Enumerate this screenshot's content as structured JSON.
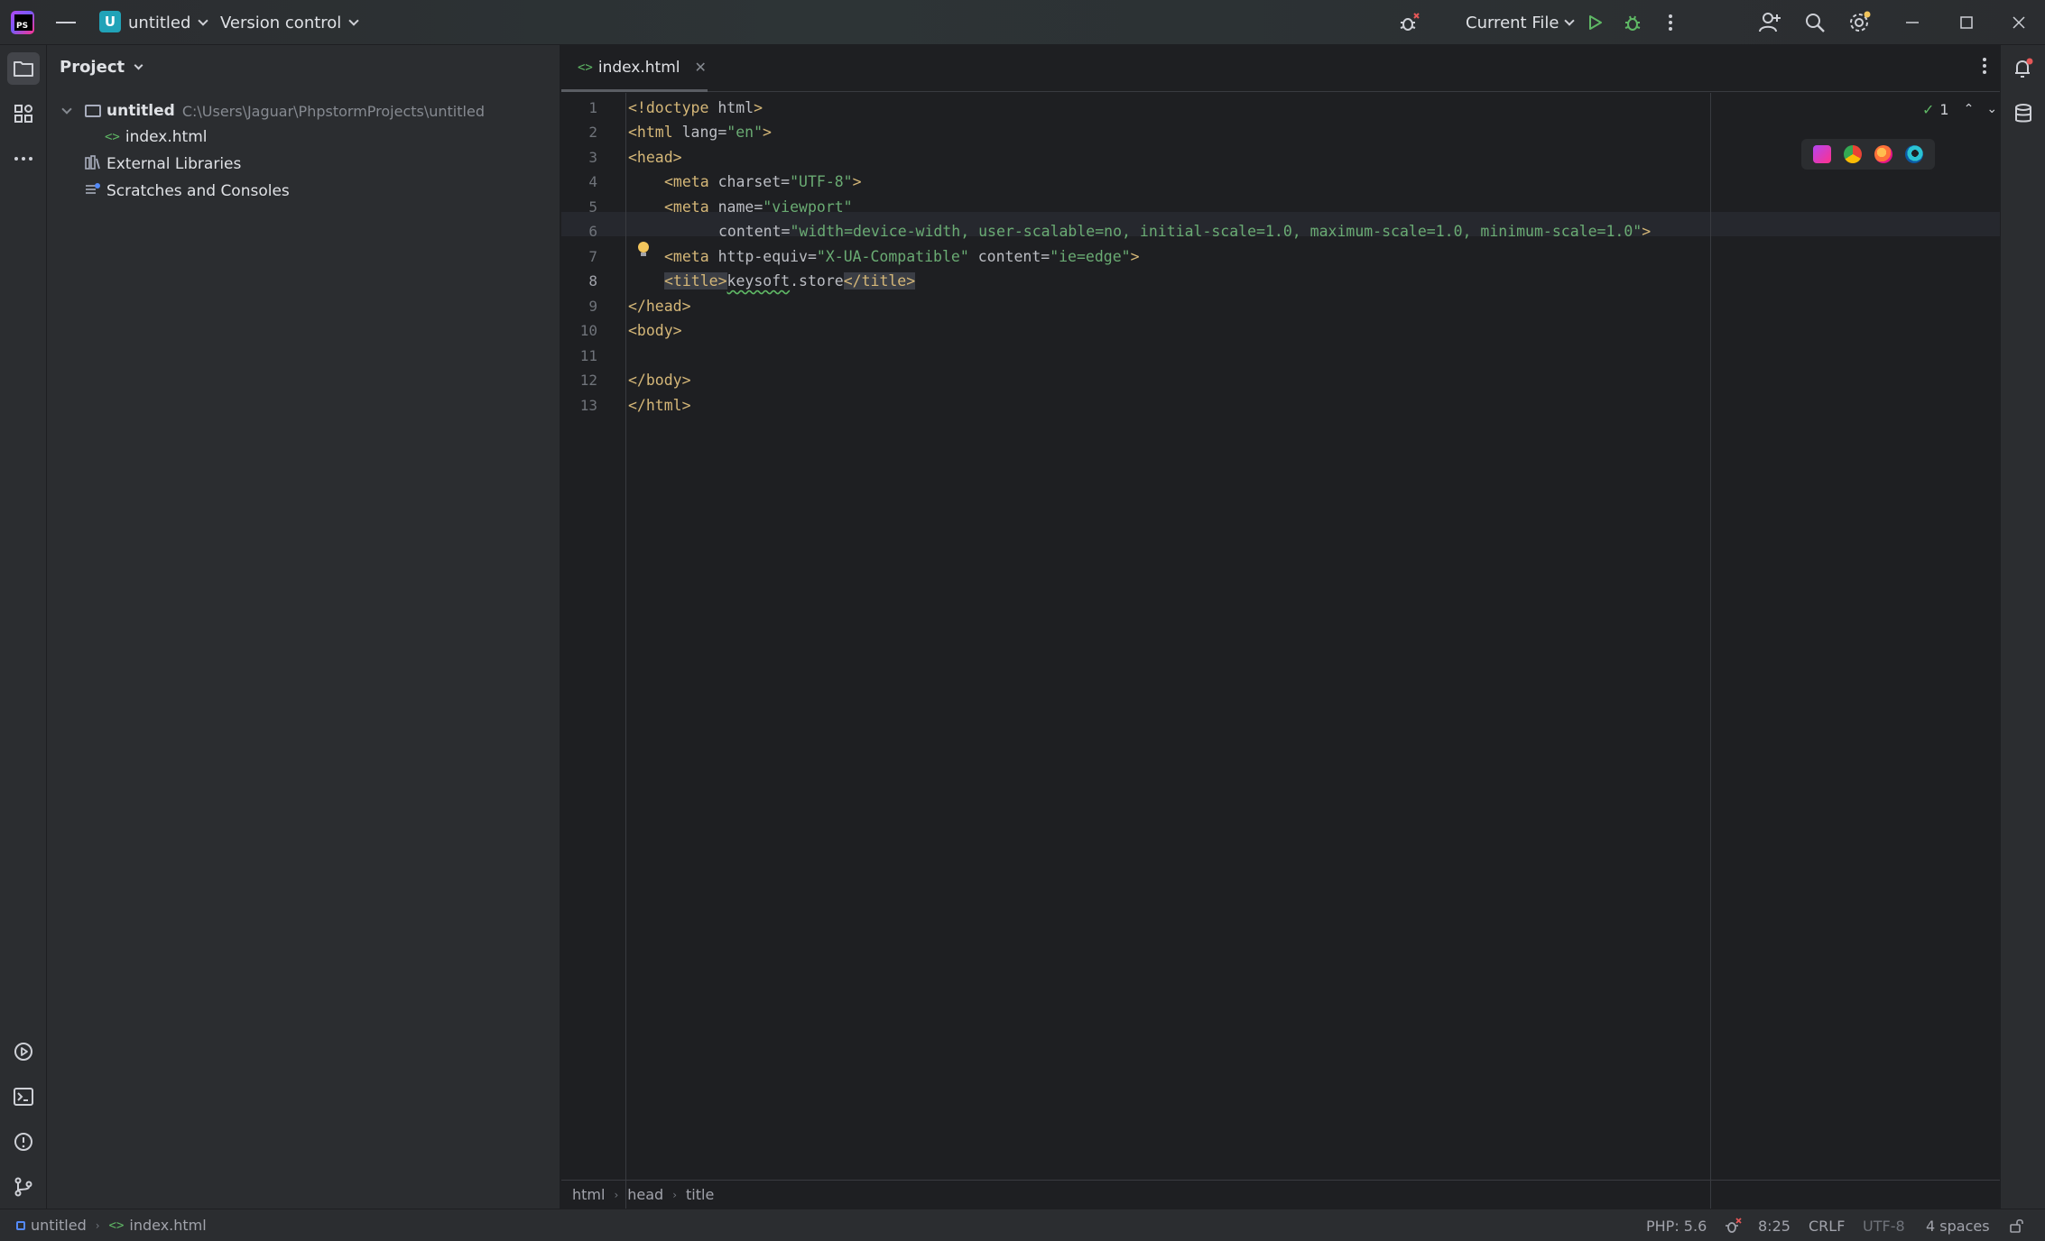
{
  "titlebar": {
    "project_badge": "U",
    "project_name": "untitled",
    "vcs_label": "Version control",
    "run_config": "Current File",
    "icons": [
      "menu-icon",
      "debug-bug-icon",
      "run-icon",
      "debug-icon",
      "more-vertical-icon",
      "add-user-icon",
      "search-icon",
      "settings-icon",
      "minimize-icon",
      "maximize-icon",
      "close-icon"
    ]
  },
  "project_panel": {
    "title": "Project",
    "tree": [
      {
        "label": "untitled",
        "path": "C:\\Users\\Jaguar\\PhpstormProjects\\untitled"
      },
      {
        "label": "index.html"
      },
      {
        "label": "External Libraries"
      },
      {
        "label": "Scratches and Consoles"
      }
    ]
  },
  "editor": {
    "tab_label": "index.html",
    "current_line": 8,
    "line_numbers": [
      "1",
      "2",
      "3",
      "4",
      "5",
      "6",
      "7",
      "8",
      "9",
      "10",
      "11",
      "12",
      "13"
    ],
    "code": {
      "l1": {
        "tag": "<!doctype",
        "rest": " html",
        "close": ">"
      },
      "l2": {
        "tag": "<html",
        "attr": " lang=",
        "val": "\"en\"",
        "close": ">"
      },
      "l3": {
        "tag": "<head>"
      },
      "l4": {
        "tag": "<meta",
        "attr": " charset=",
        "val": "\"UTF-8\"",
        "close": ">"
      },
      "l5": {
        "tag": "<meta",
        "attr": " name=",
        "val": "\"viewport\""
      },
      "l6": {
        "attr": "content=",
        "val": "\"width=device-width, user-scalable=no, initial-scale=1.0, maximum-scale=1.0, minimum-scale=1.0\"",
        "close": ">"
      },
      "l7": {
        "tag": "<meta",
        "attr1": " http-equiv=",
        "val1": "\"X-UA-Compatible\"",
        "attr2": " content=",
        "val2": "\"ie=edge\"",
        "close": ">"
      },
      "l8": {
        "open": "<title>",
        "word": "keysoft",
        "rest": ".store",
        "close": "</title>"
      },
      "l9": {
        "tag": "</head>"
      },
      "l10": {
        "tag": "<body>"
      },
      "l12": {
        "tag": "</body>"
      },
      "l13": {
        "tag": "</html>"
      }
    },
    "inspection_count": "1",
    "breadcrumbs": [
      "html",
      "head",
      "title"
    ]
  },
  "statusbar": {
    "path_project": "untitled",
    "path_file": "index.html",
    "php_version": "PHP: 5.6",
    "position": "8:25",
    "line_sep": "CRLF",
    "encoding": "UTF-8",
    "indent": "4 spaces"
  }
}
